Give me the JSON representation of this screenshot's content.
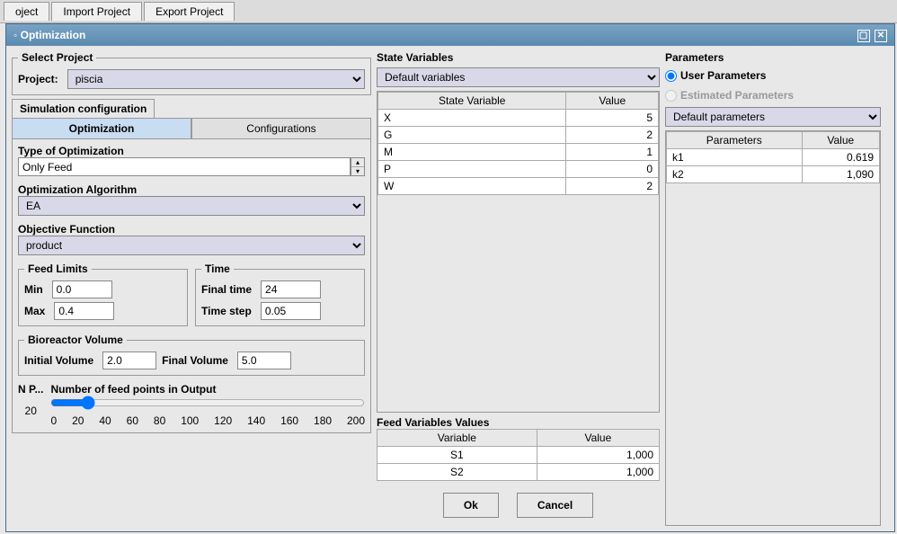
{
  "toolbar": {
    "tab0": "oject",
    "tab1": "Import Project",
    "tab2": "Export Project"
  },
  "window": {
    "title": "Optimization"
  },
  "selectProject": {
    "legend": "Select Project",
    "label": "Project:",
    "value": "piscia"
  },
  "simConfig": {
    "label": "Simulation configuration",
    "tabOpt": "Optimization",
    "tabConf": "Configurations"
  },
  "typeOpt": {
    "label": "Type of Optimization",
    "value": "Only Feed"
  },
  "algo": {
    "label": "Optimization Algorithm",
    "value": "EA"
  },
  "objFn": {
    "label": "Objective Function",
    "value": "product"
  },
  "feedLimits": {
    "legend": "Feed Limits",
    "minLabel": "Min",
    "minVal": "0.0",
    "maxLabel": "Max",
    "maxVal": "0.4"
  },
  "time": {
    "legend": "Time",
    "finalLabel": "Final time",
    "finalVal": "24",
    "stepLabel": "Time step",
    "stepVal": "0.05"
  },
  "volume": {
    "legend": "Bioreactor Volume",
    "initLabel": "Initial Volume",
    "initVal": "2.0",
    "finalLabel": "Final Volume",
    "finalVal": "5.0"
  },
  "feedPts": {
    "shortLabel": "N P...",
    "value": "20",
    "caption": "Number of feed points in Output",
    "ticks": [
      "0",
      "20",
      "40",
      "60",
      "80",
      "100",
      "120",
      "140",
      "160",
      "180",
      "200"
    ]
  },
  "stateVars": {
    "title": "State Variables",
    "dropdown": "Default variables",
    "cols": [
      "State Variable",
      "Value"
    ],
    "rows": [
      {
        "n": "X",
        "v": "5"
      },
      {
        "n": "G",
        "v": "2"
      },
      {
        "n": "M",
        "v": "1"
      },
      {
        "n": "P",
        "v": "0"
      },
      {
        "n": "W",
        "v": "2"
      }
    ]
  },
  "feedVals": {
    "title": "Feed Variables Values",
    "cols": [
      "Variable",
      "Value"
    ],
    "rows": [
      {
        "n": "S1",
        "v": "1,000"
      },
      {
        "n": "S2",
        "v": "1,000"
      }
    ]
  },
  "params": {
    "title": "Parameters",
    "radio1": "User Parameters",
    "radio2": "Estimated Parameters",
    "dropdown": "Default parameters",
    "cols": [
      "Parameters",
      "Value"
    ],
    "rows": [
      {
        "n": "k1",
        "v": "0.619"
      },
      {
        "n": "k2",
        "v": "1,090"
      }
    ]
  },
  "buttons": {
    "ok": "Ok",
    "cancel": "Cancel"
  }
}
